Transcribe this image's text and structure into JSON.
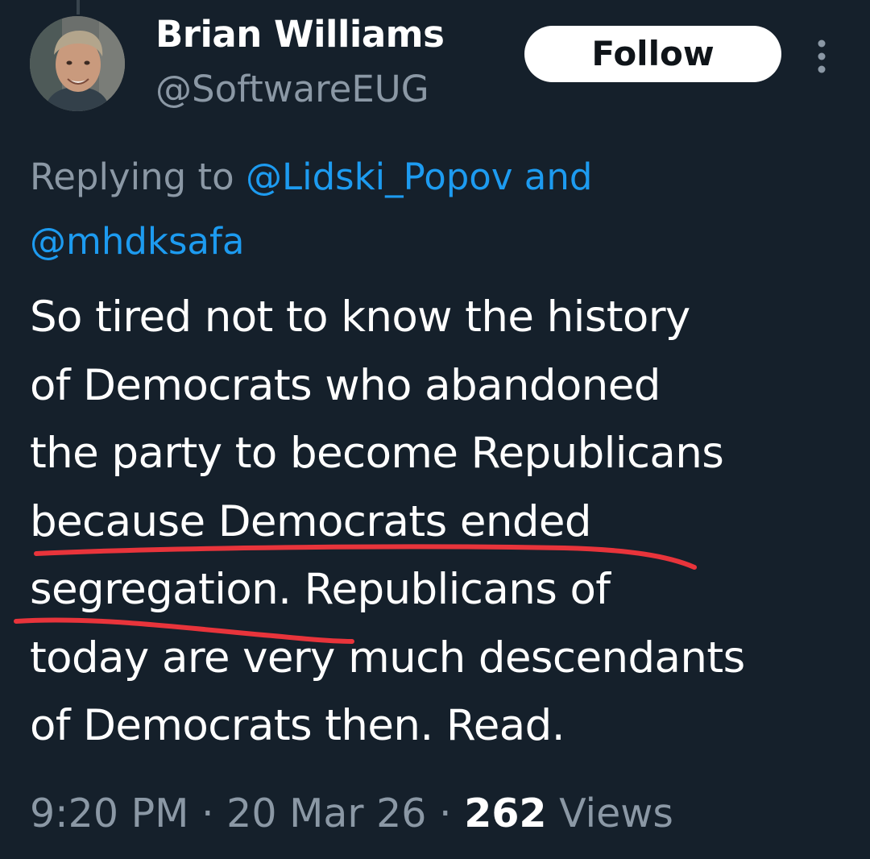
{
  "author": {
    "name": "Brian Williams",
    "handle": "@SoftwareEUG"
  },
  "follow_label": "Follow",
  "reply": {
    "prefix": "Replying to ",
    "mention_1": "@Lidski_Popov",
    "conjunction": " and",
    "mention_2": "@mhdksafa"
  },
  "tweet": {
    "lines": [
      "So tired not to know the history",
      "of Democrats who abandoned",
      "the party to become Republicans",
      "because Democrats ended",
      "segregation. Republicans of",
      "today are very much descendants",
      "of Democrats then. Read."
    ]
  },
  "meta": {
    "time": "9:20 PM",
    "separator": " · ",
    "date": "20 Mar 26",
    "views_count": "262",
    "views_label": " Views"
  },
  "colors": {
    "background": "#15202b",
    "secondary_text": "#8b98a5",
    "link": "#1d9bf0",
    "annotation": "#e8343b"
  },
  "icons": {
    "more": "more-vertical-icon"
  }
}
